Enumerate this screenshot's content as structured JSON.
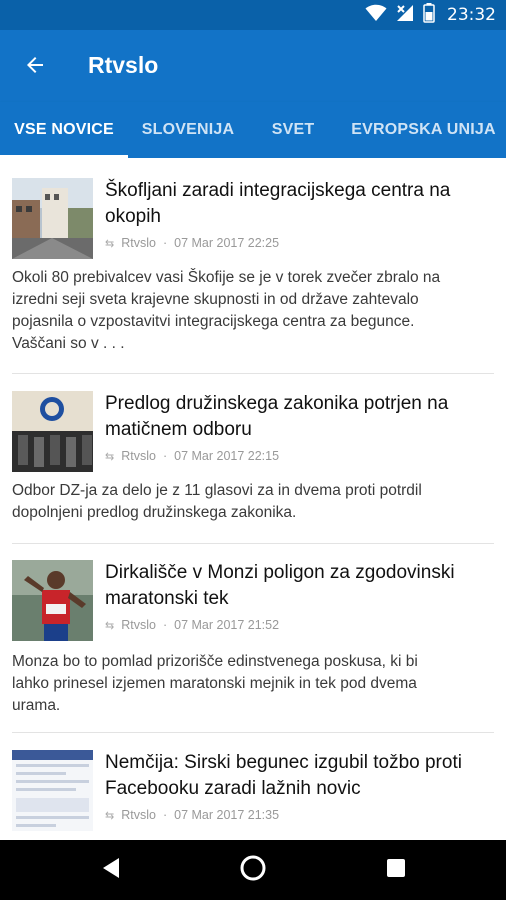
{
  "status_bar": {
    "time": "23:32",
    "icons": [
      "wifi-icon",
      "no-signal-icon",
      "battery-icon"
    ]
  },
  "app_bar": {
    "title": "Rtvslo",
    "back_icon": "arrow-back-icon"
  },
  "tabs": [
    {
      "label": "VSE NOVICE",
      "active": true
    },
    {
      "label": "SLOVENIJA",
      "active": false
    },
    {
      "label": "SVET",
      "active": false
    },
    {
      "label": "EVROPSKA UNIJA",
      "active": false
    }
  ],
  "articles": [
    {
      "headline_lines": [
        "Škofljani zaradi integracijskega centra na",
        "okopih"
      ],
      "source": "Rtvslo",
      "datetime": "07 Mar 2017 22:25",
      "summary_lines": [
        "Okoli 80 prebivalcev vasi Škofije se je v torek zvečer zbralo na",
        "izredni seji sveta krajevne skupnosti in od države zahtevalo",
        "pojasnila o vzpostavitvi integracijskega centra za begunce.",
        "Vaščani so v . . ."
      ]
    },
    {
      "headline_lines": [
        "Predlog družinskega zakonika potrjen na",
        "matičnem odboru"
      ],
      "source": "Rtvslo",
      "datetime": "07 Mar 2017 22:15",
      "summary_lines": [
        "Odbor DZ-ja za delo je z 11 glasovi za in dvema proti potrdil",
        "dopolnjeni predlog družinskega zakonika."
      ]
    },
    {
      "headline_lines": [
        "Dirkališče v Monzi poligon za zgodovinski",
        "maratonski tek"
      ],
      "source": "Rtvslo",
      "datetime": "07 Mar 2017 21:52",
      "summary_lines": [
        "Monza bo to pomlad prizorišče edinstvenega poskusa, ki bi",
        "lahko prinesel izjemen maratonski mejnik in tek pod dvema",
        "urama."
      ]
    },
    {
      "headline_lines": [
        "Nemčija: Sirski begunec izgubil tožbo proti",
        "Facebooku zaradi lažnih novic"
      ],
      "source": "Rtvslo",
      "datetime": "07 Mar 2017 21:35",
      "summary_lines": []
    }
  ],
  "nav_bar": {
    "icons": [
      "back-triangle-icon",
      "home-circle-icon",
      "recents-square-icon"
    ]
  },
  "colors": {
    "primary": "#1273c7",
    "status_bar": "#0a61a9"
  }
}
